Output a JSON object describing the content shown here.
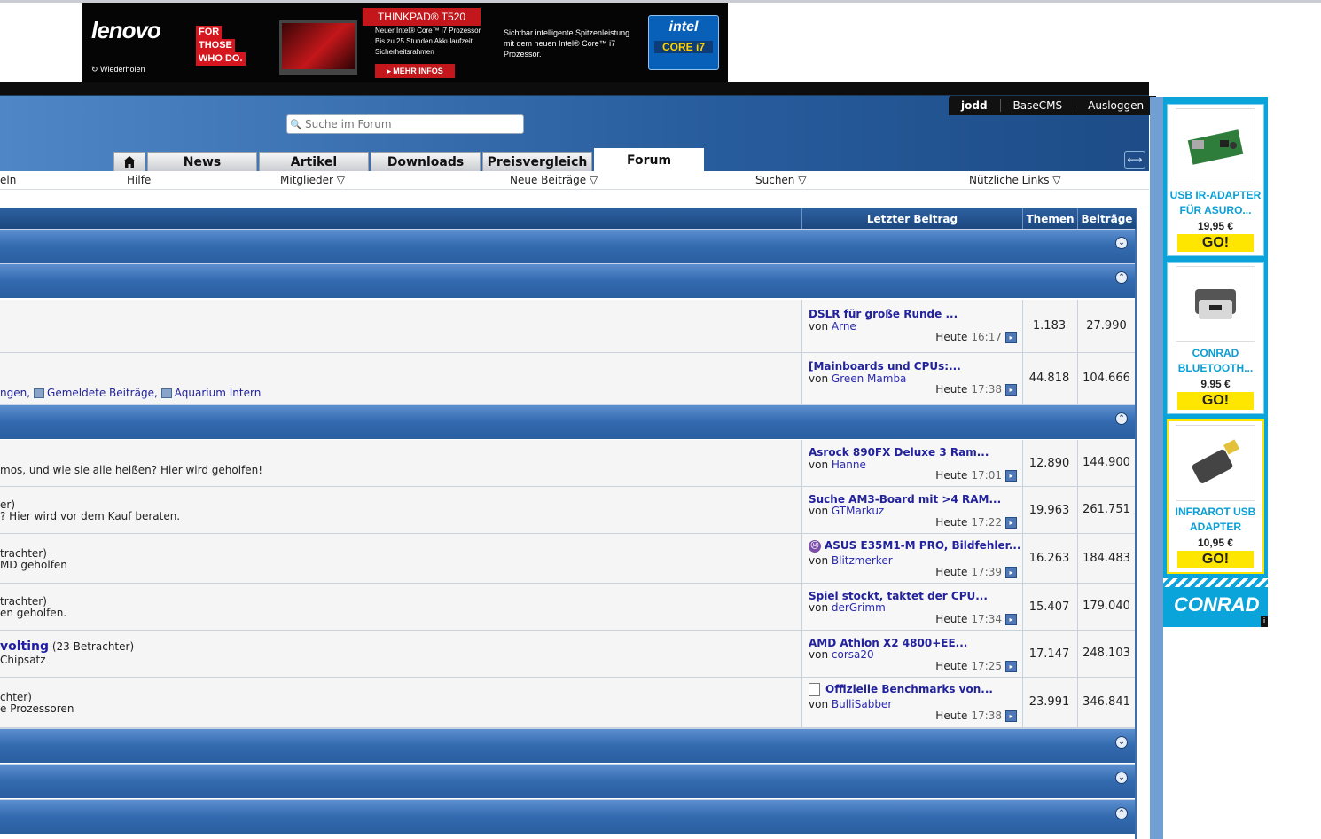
{
  "banner": {
    "brand": "lenovo",
    "tag1": "FOR",
    "tag2": "THOSE",
    "tag3": "WHO DO.",
    "replay": "↻ Wiederholen",
    "model": "THINKPAD® T520",
    "spec_line1": "Neuer Intel® Core™ i7 Prozessor",
    "spec_line2": "Bis zu 25 Stunden Akkulaufzeit",
    "spec_line3": "Sicherheitsrahmen",
    "more": "▸ MEHR INFOS",
    "spec2_line1": "Sichtbar intelligente Spitzenleistung",
    "spec2_line2": "mit dem neuen Intel® Core™ i7",
    "spec2_line3": "Prozessor.",
    "intel_logo": "intel",
    "intel_core": "CORE i7"
  },
  "user": {
    "name": "jodd",
    "link1": "BaseCMS",
    "logout": "Ausloggen"
  },
  "search": {
    "placeholder": "Suche im Forum"
  },
  "tabs": {
    "news": "News",
    "artikel": "Artikel",
    "downloads": "Downloads",
    "preisvergleich": "Preisvergleich",
    "forum": "Forum"
  },
  "subnav": {
    "item0": "eln",
    "hilfe": "Hilfe",
    "mitglieder": "Mitglieder ▽",
    "neue": "Neue Beiträge ▽",
    "suchen": "Suchen ▽",
    "links": "Nützliche Links ▽"
  },
  "columns": {
    "last": "Letzter Beitrag",
    "themen": "Themen",
    "beitraege": "Beiträge"
  },
  "toggle": {
    "collapsed": "⌄",
    "expanded": "⌃"
  },
  "rows": [
    {
      "d1": "",
      "d2": "",
      "title": "DSLR für große Runde ...",
      "by": "von",
      "user": "Arne",
      "day": "Heute",
      "time": "16:17",
      "themen": "1.183",
      "beitraege": "27.990"
    },
    {
      "d2a": "ngen,",
      "d2b": "Gemeldete Beiträge,",
      "d2c": "Aquarium Intern",
      "title": "[Mainboards und CPUs:...",
      "by": "von",
      "user": "Green Mamba",
      "day": "Heute",
      "time": "17:38",
      "themen": "44.818",
      "beitraege": "104.666"
    },
    {
      "d1": "mos, und wie sie alle heißen? Hier wird geholfen!",
      "title": "Asrock 890FX Deluxe 3 Ram...",
      "by": "von",
      "user": "Hanne",
      "day": "Heute",
      "time": "17:01",
      "themen": "12.890",
      "beitraege": "144.900"
    },
    {
      "d1": "er)",
      "d2": "? Hier wird vor dem Kauf beraten.",
      "title": "Suche AM3-Board mit >4 RAM...",
      "by": "von",
      "user": "GTMarkuz",
      "day": "Heute",
      "time": "17:22",
      "themen": "19.963",
      "beitraege": "261.751"
    },
    {
      "d1": "trachter)",
      "d2": "MD geholfen",
      "title": "ASUS E35M1-M PRO, Bildfehler...",
      "by": "von",
      "user": "Blitzmerker",
      "day": "Heute",
      "time": "17:39",
      "themen": "16.263",
      "beitraege": "184.483"
    },
    {
      "d1": "trachter)",
      "d2": "en geholfen.",
      "title": "Spiel stockt, taktet der CPU...",
      "by": "von",
      "user": "derGrimm",
      "day": "Heute",
      "time": "17:34",
      "themen": "15.407",
      "beitraege": "179.040"
    },
    {
      "d1a": "volting",
      "d1b": " (23 Betrachter)",
      "d2": "Chipsatz",
      "title": "AMD Athlon X2 4800+EE...",
      "by": "von",
      "user": "corsa20",
      "day": "Heute",
      "time": "17:25",
      "themen": "17.147",
      "beitraege": "248.103"
    },
    {
      "d1": "chter)",
      "d2": "e Prozessoren",
      "title": "Offizielle Benchmarks von...",
      "by": "von",
      "user": "BulliSabber",
      "day": "Heute",
      "time": "17:38",
      "themen": "23.991",
      "beitraege": "346.841"
    }
  ],
  "sidead": {
    "p1_name1": "USB IR-ADAPTER",
    "p1_name2": "FÜR ASURO...",
    "p1_price": "19,95 €",
    "p2_name1": "CONRAD",
    "p2_name2": "BLUETOOTH...",
    "p2_price": "9,95 €",
    "p3_name1": "INFRAROT USB",
    "p3_name2": "ADAPTER",
    "p3_price": "10,95 €",
    "go": "GO!",
    "brand": "CONRAD",
    "info": "i"
  }
}
